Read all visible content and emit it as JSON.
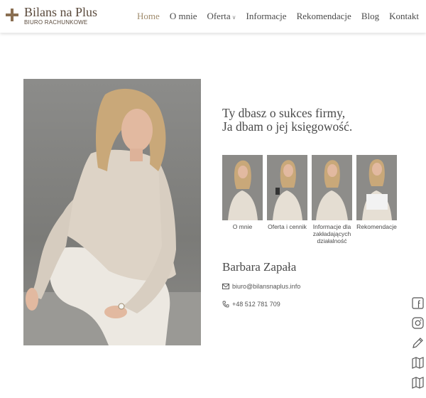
{
  "brand": {
    "title": "Bilans na Plus",
    "subtitle": "BIURO RACHUNKOWE",
    "color": "#8a6f52"
  },
  "nav": {
    "items": [
      {
        "label": "Home",
        "active": true
      },
      {
        "label": "O mnie"
      },
      {
        "label": "Oferta",
        "has_dropdown": true
      },
      {
        "label": "Informacje"
      },
      {
        "label": "Rekomendacje"
      },
      {
        "label": "Blog"
      },
      {
        "label": "Kontakt"
      }
    ],
    "active_color": "#a08c6e"
  },
  "hero": {
    "tagline_line1": "Ty dbasz o sukces firmy,",
    "tagline_line2": "Ja dbam o jej księgowość."
  },
  "thumbs": [
    {
      "label": "O mnie"
    },
    {
      "label": "Oferta i cennik"
    },
    {
      "label": "Informacje dla zakładających działalność"
    },
    {
      "label": "Rekomendacje"
    }
  ],
  "contact": {
    "name": "Barbara Zapała",
    "email": "biuro@bilansnaplus.info",
    "phone": "+48 512 781 709"
  },
  "side_icons": [
    "facebook-icon",
    "instagram-icon",
    "pencil-icon",
    "map-icon",
    "map-icon"
  ]
}
